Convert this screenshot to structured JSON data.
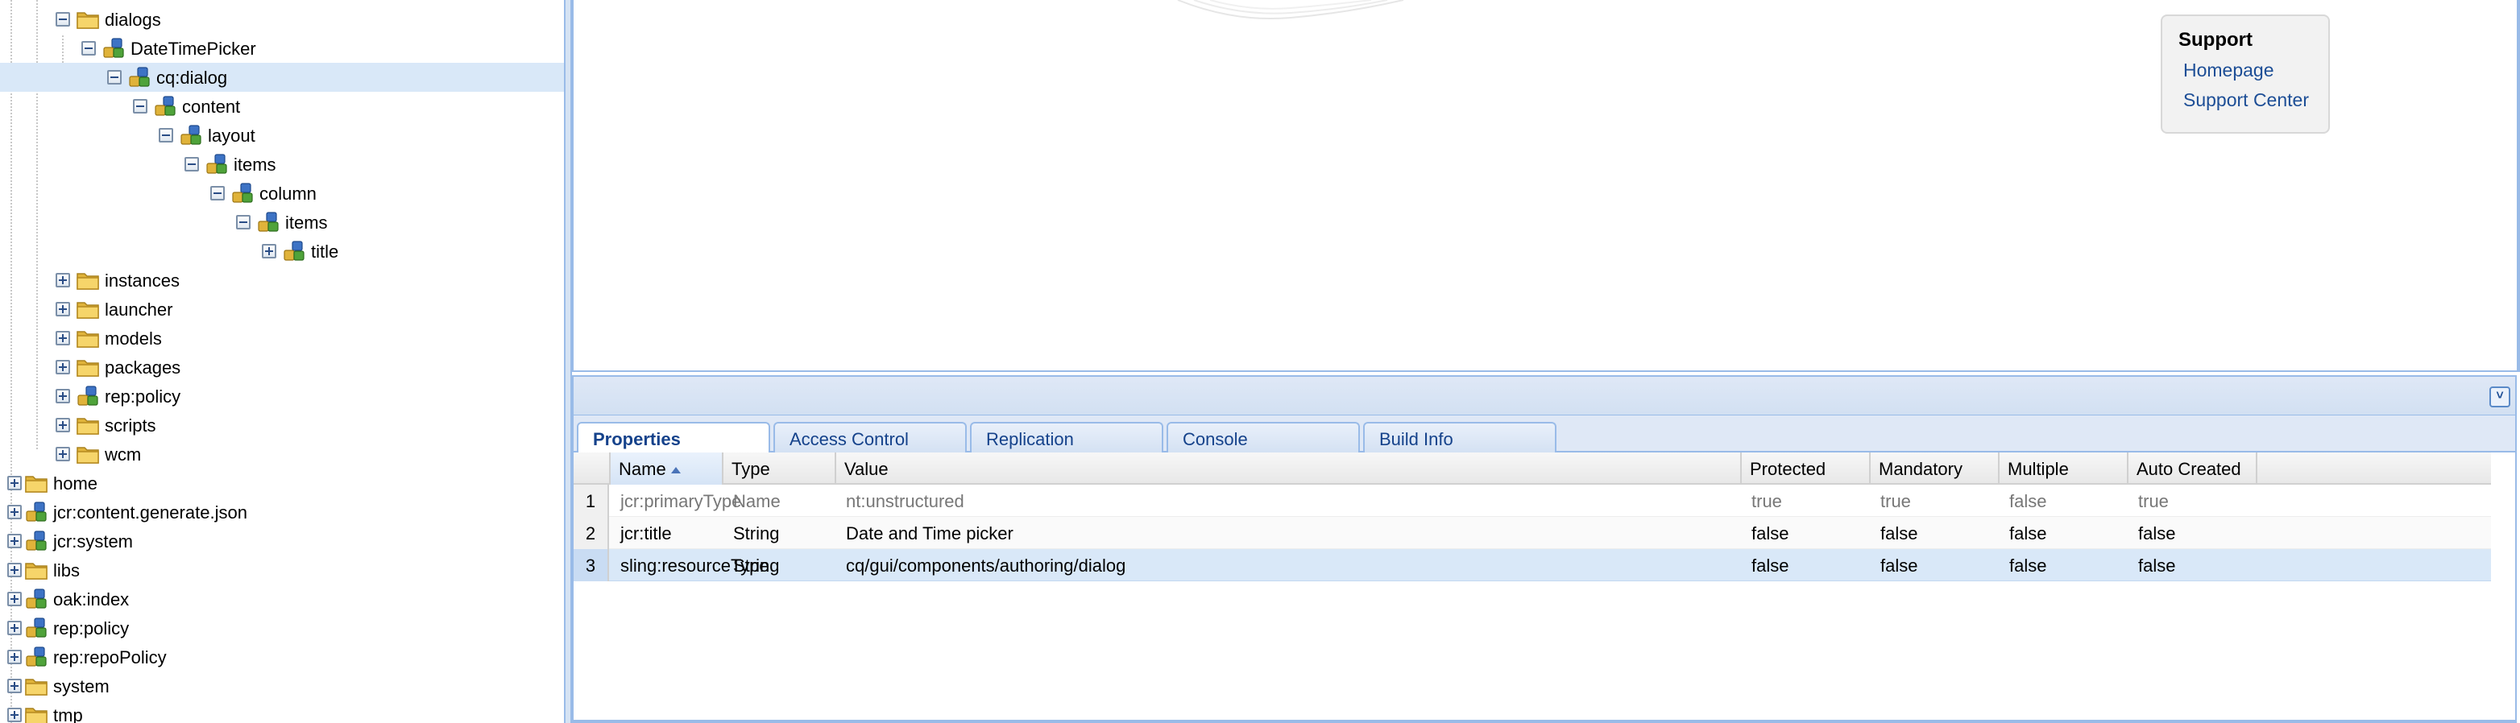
{
  "tree": {
    "nodes": [
      {
        "label": "dialogs",
        "icon": "folder-icon",
        "toggle": "minus"
      },
      {
        "label": "DateTimePicker",
        "icon": "node-icon",
        "toggle": "minus"
      },
      {
        "label": "cq:dialog",
        "icon": "node-icon",
        "toggle": "minus",
        "selected": true
      },
      {
        "label": "content",
        "icon": "node-icon",
        "toggle": "minus"
      },
      {
        "label": "layout",
        "icon": "node-icon",
        "toggle": "minus"
      },
      {
        "label": "items",
        "icon": "node-icon",
        "toggle": "minus"
      },
      {
        "label": "column",
        "icon": "node-icon",
        "toggle": "minus"
      },
      {
        "label": "items",
        "icon": "node-icon",
        "toggle": "minus"
      },
      {
        "label": "title",
        "icon": "node-icon",
        "toggle": "plus"
      },
      {
        "label": "instances",
        "icon": "folder-icon",
        "toggle": "plus"
      },
      {
        "label": "launcher",
        "icon": "folder-icon",
        "toggle": "plus"
      },
      {
        "label": "models",
        "icon": "folder-icon",
        "toggle": "plus"
      },
      {
        "label": "packages",
        "icon": "folder-icon",
        "toggle": "plus"
      },
      {
        "label": "rep:policy",
        "icon": "node-icon",
        "toggle": "plus"
      },
      {
        "label": "scripts",
        "icon": "folder-icon",
        "toggle": "plus"
      },
      {
        "label": "wcm",
        "icon": "folder-icon",
        "toggle": "plus"
      },
      {
        "label": "home",
        "icon": "folder-icon",
        "toggle": "plus"
      },
      {
        "label": "jcr:content.generate.json",
        "icon": "node-icon",
        "toggle": "plus"
      },
      {
        "label": "jcr:system",
        "icon": "node-icon",
        "toggle": "plus"
      },
      {
        "label": "libs",
        "icon": "folder-icon",
        "toggle": "plus"
      },
      {
        "label": "oak:index",
        "icon": "node-icon",
        "toggle": "plus"
      },
      {
        "label": "rep:policy",
        "icon": "node-icon",
        "toggle": "plus"
      },
      {
        "label": "rep:repoPolicy",
        "icon": "node-icon",
        "toggle": "plus"
      },
      {
        "label": "system",
        "icon": "folder-icon",
        "toggle": "plus"
      },
      {
        "label": "tmp",
        "icon": "folder-icon",
        "toggle": "plus"
      }
    ]
  },
  "support": {
    "title": "Support",
    "links": [
      "Homepage",
      "Support Center"
    ]
  },
  "tabs": [
    "Properties",
    "Access Control",
    "Replication",
    "Console",
    "Build Info"
  ],
  "grid": {
    "columns": [
      "Name",
      "Type",
      "Value",
      "Protected",
      "Mandatory",
      "Multiple",
      "Auto Created"
    ],
    "sorted_column": "Name",
    "rows": [
      {
        "num": "1",
        "cells": [
          "jcr:primaryType",
          "Name",
          "nt:unstructured",
          "true",
          "true",
          "false",
          "true"
        ],
        "protected": true
      },
      {
        "num": "2",
        "cells": [
          "jcr:title",
          "String",
          "Date and Time picker",
          "false",
          "false",
          "false",
          "false"
        ]
      },
      {
        "num": "3",
        "cells": [
          "sling:resourceType",
          "String",
          "cq/gui/components/authoring/dialog",
          "false",
          "false",
          "false",
          "false"
        ],
        "selected": true
      }
    ]
  },
  "colors": {
    "selection": "#d9e8f8",
    "panel_border": "#99bbe8",
    "tab_text": "#15428b",
    "link": "#1d4e96"
  }
}
